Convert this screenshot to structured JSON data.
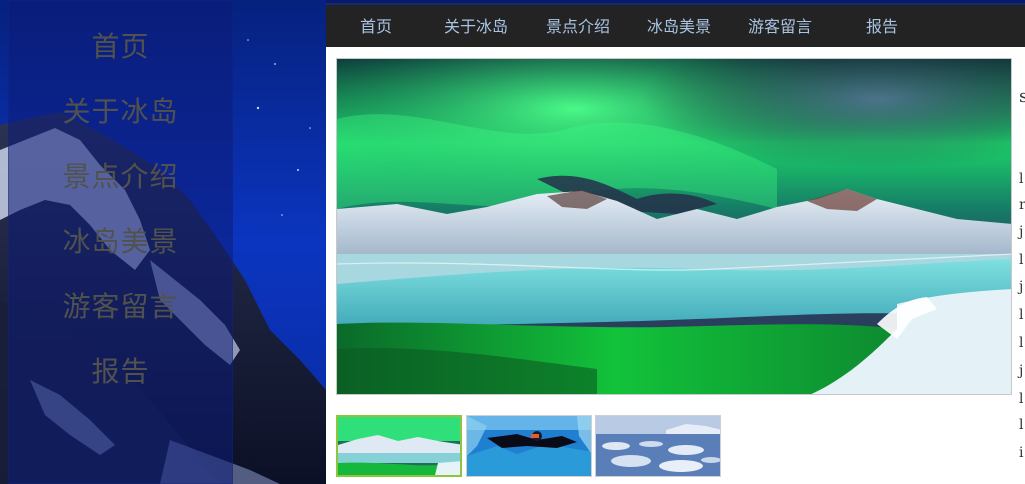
{
  "side_nav": {
    "items": [
      {
        "label": "首页"
      },
      {
        "label": "关于冰岛"
      },
      {
        "label": "景点介绍"
      },
      {
        "label": "冰岛美景"
      },
      {
        "label": "游客留言"
      },
      {
        "label": "报告"
      }
    ]
  },
  "top_nav": {
    "items": [
      {
        "label": "首页"
      },
      {
        "label": "关于冰岛"
      },
      {
        "label": "景点介绍"
      },
      {
        "label": "冰岛美景"
      },
      {
        "label": "游客留言"
      },
      {
        "label": "报告"
      }
    ]
  },
  "gallery": {
    "main_image": "aurora-over-snowy-mountains",
    "thumbnails": [
      {
        "image": "aurora-thumbnail",
        "selected": true
      },
      {
        "image": "diver-between-ice-thumbnail",
        "selected": false
      },
      {
        "image": "ice-floes-thumbnail",
        "selected": false
      }
    ]
  },
  "colors": {
    "top_nav_bg": "#232323",
    "top_nav_text": "#a9c4e4",
    "side_nav_text": "#51524e",
    "thumb_active_border": "#8cc63f"
  }
}
